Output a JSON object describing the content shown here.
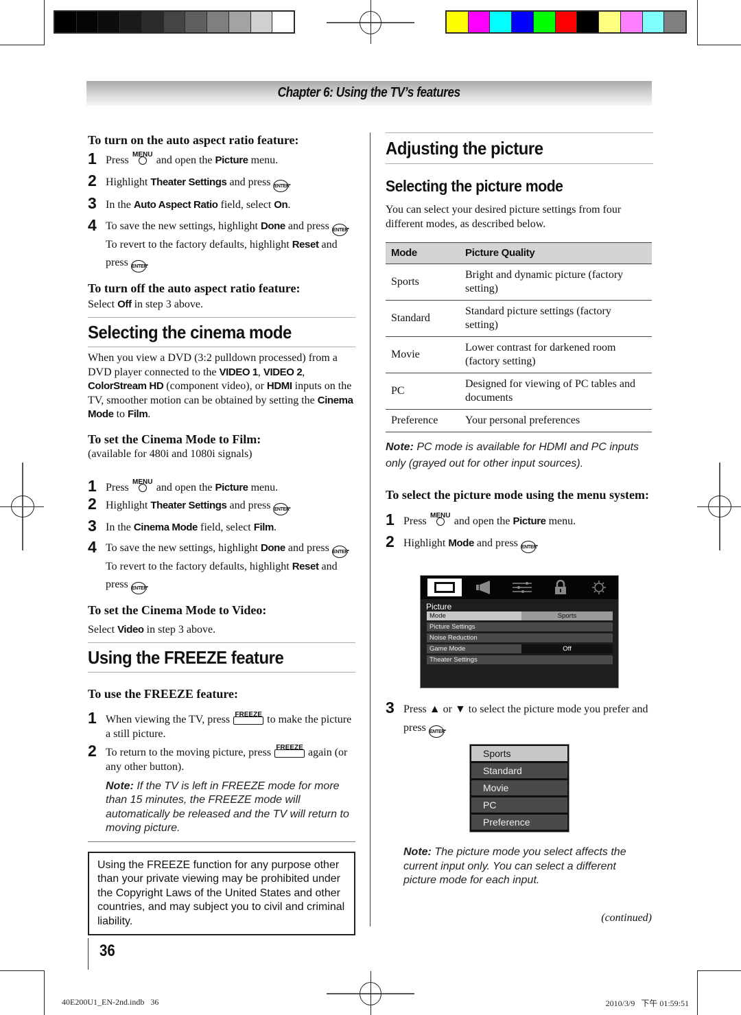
{
  "print_marks": {
    "gray_swatches": [
      "#000000",
      "#050505",
      "#0d0d0d",
      "#1a1a1a",
      "#2b2b2b",
      "#444444",
      "#5f5f5f",
      "#7f7f7f",
      "#a3a3a3",
      "#d0d0d0",
      "#ffffff"
    ],
    "color_swatches": [
      "#ffff00",
      "#ff00ff",
      "#00ffff",
      "#0000ff",
      "#00ff00",
      "#ff0000",
      "#000000",
      "#ffff80",
      "#ff80ff",
      "#80ffff",
      "#808080"
    ]
  },
  "chapter": {
    "title": "Chapter 6: Using the TV’s features"
  },
  "left": {
    "auto_on": {
      "heading": "To turn on the auto aspect ratio feature:",
      "steps": [
        {
          "num": "1",
          "a": "Press ",
          "icon": "MENU",
          "b": " and open the ",
          "bold1": "Picture",
          "c": " menu."
        },
        {
          "num": "2",
          "a": "Highlight ",
          "bold1": "Theater Settings",
          "b": " and press ",
          "icon": "ENTER",
          "c": "."
        },
        {
          "num": "3",
          "a": "In the ",
          "bold1": "Auto Aspect Ratio",
          "b": " field, select ",
          "bold2": "On",
          "c": "."
        },
        {
          "num": "4",
          "a": "To save the new settings, highlight ",
          "bold1": "Done",
          "b": " and press ",
          "icon": "ENTER",
          "c": ". To revert to the factory defaults, highlight ",
          "bold2": "Reset",
          "d": " and press ",
          "e": "."
        }
      ]
    },
    "auto_off": {
      "heading": "To turn off the auto aspect ratio feature:",
      "a": "Select ",
      "bold": "Off",
      "b": " in step 3 above."
    },
    "cinema": {
      "heading": "Selecting the cinema mode",
      "p1": "When you view a DVD (3:2 pulldown processed) from a DVD player connected to the ",
      "b1": "VIDEO 1",
      "p2": ", ",
      "b2": "VIDEO 2",
      "p3": ", ",
      "b3": "ColorStream HD",
      "p4": " (component video), or ",
      "b4": "HDMI",
      "p5": " inputs on the TV, smoother motion can be obtained by setting the ",
      "b5": "Cinema Mode",
      "p6": " to ",
      "b6": "Film",
      "p7": "."
    },
    "film": {
      "heading": "To set the Cinema Mode to Film:",
      "sub": "(available for 480i and 1080i signals)",
      "steps": [
        {
          "num": "1",
          "a": "Press ",
          "b": " and open the ",
          "bold1": "Picture",
          "c": " menu."
        },
        {
          "num": "2",
          "a": "Highlight ",
          "bold1": "Theater Settings",
          "b": " and press ",
          "c": "."
        },
        {
          "num": "3",
          "a": "In the ",
          "bold1": "Cinema Mode",
          "b": " field, select ",
          "bold2": "Film",
          "c": "."
        },
        {
          "num": "4",
          "a": "To save the new settings, highlight ",
          "bold1": "Done",
          "b": " and press ",
          "c": ". To revert to the factory defaults, highlight ",
          "bold2": "Reset",
          "d": " and press ",
          "e": "."
        }
      ]
    },
    "video": {
      "heading": "To set the Cinema Mode to Video:",
      "a": "Select ",
      "bold": "Video",
      "b": " in step 3 above."
    },
    "freeze": {
      "heading": "Using the FREEZE feature",
      "sub_heading": "To use the FREEZE feature:",
      "steps": [
        {
          "num": "1",
          "a": "When viewing the TV, press ",
          "b": " to make the picture a still picture."
        },
        {
          "num": "2",
          "a": "To return to the moving picture, press ",
          "b": " again (or any other button)."
        }
      ],
      "note_label": "Note:",
      "note_text": " If the TV is left in FREEZE mode for more than 15 minutes, the FREEZE mode will automatically be released and the TV will return to moving picture.",
      "warning": "Using the FREEZE function for any purpose other than your private viewing may be prohibited under the Copyright Laws of the United States and other countries, and may subject you to civil and criminal liability."
    }
  },
  "icons": {
    "menu": "MENU",
    "enter": "ENTER",
    "freeze": "FREEZE"
  },
  "right": {
    "heading": "Adjusting the picture",
    "sub_heading": "Selecting the picture mode",
    "intro": "You can select your desired picture settings from four different modes, as described below.",
    "table": {
      "headers": [
        "Mode",
        "Picture Quality"
      ],
      "rows": [
        [
          "Sports",
          "Bright and dynamic picture (factory setting)"
        ],
        [
          "Standard",
          "Standard picture settings (factory setting)"
        ],
        [
          "Movie",
          "Lower contrast for darkened room (factory setting)"
        ],
        [
          "PC",
          "Designed for viewing of PC tables and documents"
        ],
        [
          "Preference",
          "Your personal preferences"
        ]
      ]
    },
    "note1_label": "Note:",
    "note1_text": " PC mode is available for HDMI and PC inputs only (grayed out for other input sources).",
    "menu_heading": "To select the picture mode using the menu system:",
    "steps": [
      {
        "num": "1",
        "a": "Press ",
        "b": " and open the ",
        "bold1": "Picture",
        "c": " menu."
      },
      {
        "num": "2",
        "a": "Highlight ",
        "bold1": "Mode",
        "b": " and press ",
        "c": "."
      },
      {
        "num": "3",
        "a": "Press ",
        "up": "▲",
        "b": " or ",
        "down": "▼",
        "c": " to select the picture mode you prefer and press ",
        "d": "."
      }
    ],
    "tv_menu": {
      "tabs": [
        "picture-tab",
        "audio-tab",
        "settings-tab",
        "lock-tab",
        "setup-tab"
      ],
      "title": "Picture",
      "rows": [
        {
          "label": "Mode",
          "value": "Sports"
        },
        {
          "label": "Picture Settings",
          "value": ""
        },
        {
          "label": "Noise Reduction",
          "value": ""
        },
        {
          "label": "Game Mode",
          "value": "Off"
        },
        {
          "label": "Theater Settings",
          "value": ""
        }
      ]
    },
    "mode_list": [
      "Sports",
      "Standard",
      "Movie",
      "PC",
      "Preference"
    ],
    "note2_label": "Note:",
    "note2_text": " The picture mode you select affects the current input only. You can select a different picture mode for each input.",
    "continued": "(continued)"
  },
  "footer": {
    "page_number": "36",
    "slug_left": "40E200U1_EN-2nd.indb   36",
    "slug_right": "2010/3/9   下午 01:59:51"
  }
}
